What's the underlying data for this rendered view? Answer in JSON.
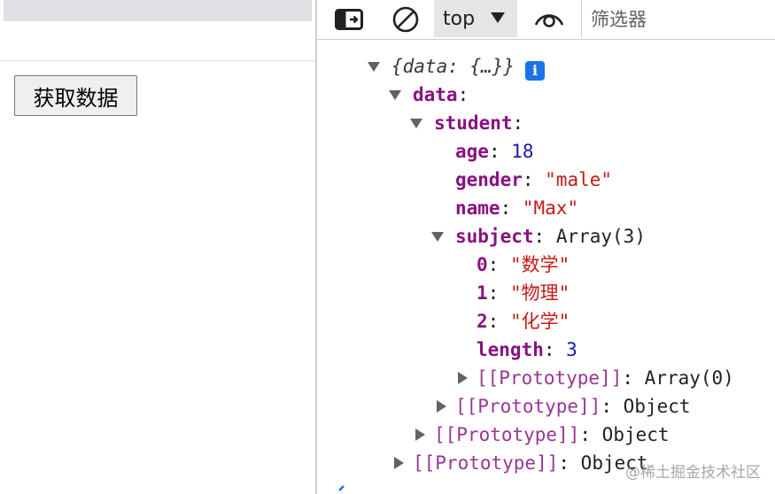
{
  "page": {
    "fetch_button_label": "获取数据"
  },
  "devtools": {
    "toolbar": {
      "context_label": "top",
      "filter_placeholder": "筛选器",
      "icons": [
        "sidebar-toggle-icon",
        "clear-console-icon",
        "dropdown-caret-icon",
        "live-expression-eye-icon"
      ]
    },
    "tree": {
      "root_preview": "{data: {…}}",
      "data_key": "data",
      "student_key": "student",
      "age_key": "age",
      "age_value": "18",
      "gender_key": "gender",
      "gender_value": "\"male\"",
      "name_key": "name",
      "name_value": "\"Max\"",
      "subject_key": "subject",
      "subject_value": "Array(3)",
      "items": [
        {
          "index": "0",
          "value": "\"数学\""
        },
        {
          "index": "1",
          "value": "\"物理\""
        },
        {
          "index": "2",
          "value": "\"化学\""
        }
      ],
      "length_key": "length",
      "length_value": "3",
      "proto_key": "[[Prototype]]",
      "proto_array_value": "Array(0)",
      "proto_object_value": "Object"
    },
    "colors": {
      "key": "#881280",
      "number": "#1a1aa6",
      "string": "#c41a16",
      "info_badge": "#1a73e8"
    }
  },
  "watermark": "@稀土掘金技术社区"
}
